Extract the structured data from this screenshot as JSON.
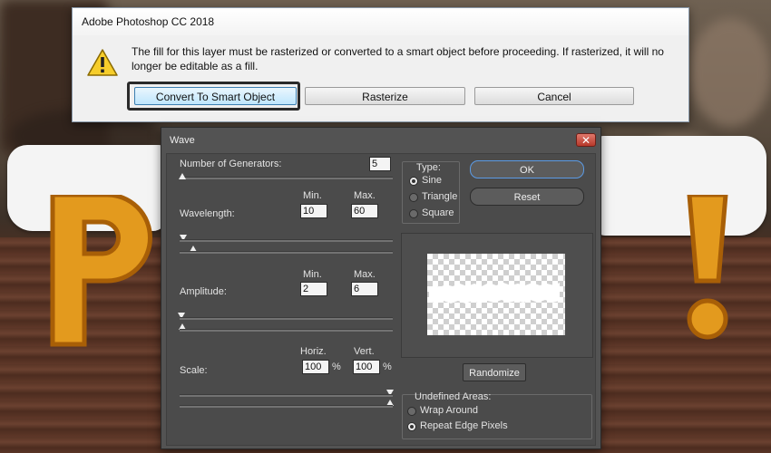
{
  "alert": {
    "title": "Adobe Photoshop CC 2018",
    "message": "The fill for this layer must be rasterized or converted to a smart object before proceeding. If rasterized, it will no longer be editable as a fill.",
    "icon": "warning-icon",
    "buttons": {
      "smart_object": "Convert To Smart Object",
      "rasterize": "Rasterize",
      "cancel": "Cancel"
    }
  },
  "wave": {
    "title": "Wave",
    "close_glyph": "✕",
    "generators": {
      "label": "Number of Generators:",
      "value": "5"
    },
    "wavelength": {
      "label": "Wavelength:",
      "min_label": "Min.",
      "max_label": "Max.",
      "min": "10",
      "max": "60"
    },
    "amplitude": {
      "label": "Amplitude:",
      "min_label": "Min.",
      "max_label": "Max.",
      "min": "2",
      "max": "6"
    },
    "scale": {
      "label": "Scale:",
      "horiz_label": "Horiz.",
      "vert_label": "Vert.",
      "horiz": "100",
      "vert": "100",
      "unit": "%"
    },
    "type": {
      "label": "Type:",
      "options": [
        "Sine",
        "Triangle",
        "Square"
      ],
      "selected": "Sine"
    },
    "buttons": {
      "ok": "OK",
      "reset": "Reset",
      "randomize": "Randomize"
    },
    "undefined_areas": {
      "label": "Undefined Areas:",
      "options": [
        "Wrap Around",
        "Repeat Edge Pixels"
      ],
      "selected": "Repeat Edge Pixels"
    }
  },
  "colors": {
    "accent": "#3c7fb1",
    "dialog_bg": "#535353",
    "ok_border": "#5b9be5",
    "artwork_letter": "#e59b1f"
  }
}
